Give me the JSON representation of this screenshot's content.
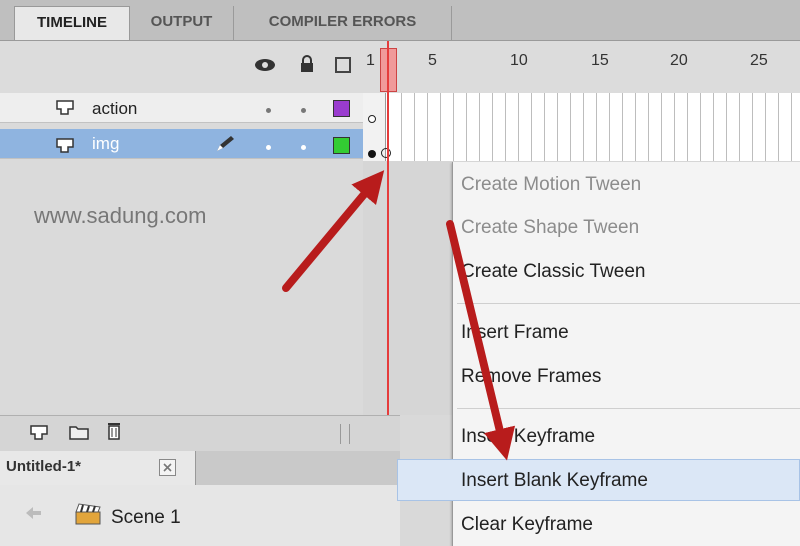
{
  "panel_tabs": [
    "TIMELINE",
    "OUTPUT",
    "COMPILER ERRORS"
  ],
  "header": {
    "first_frame": "1",
    "frame_numbers": [
      "5",
      "10",
      "15",
      "20",
      "25"
    ]
  },
  "layers": [
    {
      "name": "action",
      "color": "#9a3ccf"
    },
    {
      "name": "img",
      "color": "#33cc33"
    }
  ],
  "watermark": "www.sadung.com",
  "context_menu": {
    "items": [
      {
        "label": "Create Motion Tween",
        "disabled": true
      },
      {
        "label": "Create Shape Tween",
        "disabled": true
      },
      {
        "label": "Create Classic Tween",
        "disabled": false
      },
      {
        "label": "Insert Frame",
        "disabled": false
      },
      {
        "label": "Remove Frames",
        "disabled": false
      },
      {
        "label": "Insert Keyframe",
        "disabled": false
      },
      {
        "label": "Insert Blank Keyframe",
        "disabled": false,
        "highlighted": true
      },
      {
        "label": "Clear Keyframe",
        "disabled": false
      }
    ]
  },
  "document_tab": {
    "label": "Untitled-1*"
  },
  "scene": {
    "label": "Scene 1"
  },
  "colors": {
    "playhead": "#e53c3c",
    "selected_layer": "#8fb4e0",
    "arrow": "#b81c1c"
  }
}
